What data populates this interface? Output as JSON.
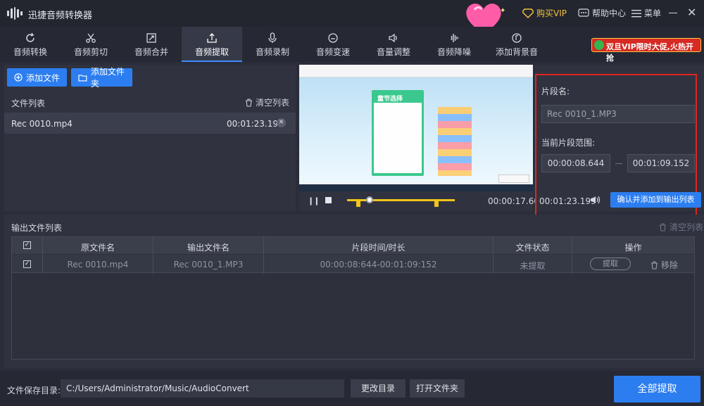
{
  "app": {
    "title": "迅捷音频转换器"
  },
  "titlebar": {
    "vip_label": "购买VIP",
    "help_label": "帮助中心",
    "menu_label": "菜单"
  },
  "tabs": [
    {
      "label": "音频转换",
      "icon": "refresh-icon"
    },
    {
      "label": "音频剪切",
      "icon": "scissors-icon"
    },
    {
      "label": "音频合并",
      "icon": "merge-icon"
    },
    {
      "label": "音频提取",
      "icon": "upload-icon",
      "active": true
    },
    {
      "label": "音频录制",
      "icon": "microphone-icon"
    },
    {
      "label": "音频变速",
      "icon": "speed-icon"
    },
    {
      "label": "音量调整",
      "icon": "volume-icon"
    },
    {
      "label": "音频降噪",
      "icon": "waveform-icon"
    },
    {
      "label": "添加背景音",
      "icon": "music-note-icon"
    }
  ],
  "promo": {
    "text": "双旦VIP限时大促,火热开抢"
  },
  "file_panel": {
    "add_file_label": "添加文件",
    "add_folder_label": "添加文件夹",
    "list_title": "文件列表",
    "clear_label": "清空列表",
    "files": [
      {
        "name": "Rec 0010.mp4",
        "duration": "00:01:23.199"
      }
    ]
  },
  "preview": {
    "card_title": "童节选择"
  },
  "player": {
    "current_time": "00:00:17.600",
    "total_time": "00:01:23.199",
    "selection_start": 0.104,
    "selection_end": 0.832,
    "playhead": 0.212
  },
  "segment": {
    "name_label": "片段名:",
    "name_value": "Rec 0010_1.MP3",
    "range_label": "当前片段范围:",
    "range_start": "00:00:08.644",
    "range_end": "00:01:09.152",
    "confirm_label": "确认并添加到输出列表"
  },
  "output": {
    "title": "输出文件列表",
    "clear_label": "清空列表",
    "headers": [
      "原文件名",
      "输出文件名",
      "片段时间/时长",
      "文件状态",
      "操作"
    ],
    "rows": [
      {
        "checked": true,
        "source": "Rec 0010.mp4",
        "output": "Rec 0010_1.MP3",
        "segment": "00:00:08:644-00:01:09:152",
        "status": "未提取",
        "extract_label": "提取",
        "remove_label": "移除"
      }
    ]
  },
  "bottom": {
    "save_dir_label": "文件保存目录:",
    "save_path": "C:/Users/Administrator/Music/AudioConvert",
    "change_dir_label": "更改目录",
    "open_folder_label": "打开文件夹",
    "extract_all_label": "全部提取"
  },
  "colors": {
    "accent": "#2c7ef0",
    "highlight": "#e0251f",
    "marker": "#f0c419",
    "vip": "#f2c23a"
  }
}
